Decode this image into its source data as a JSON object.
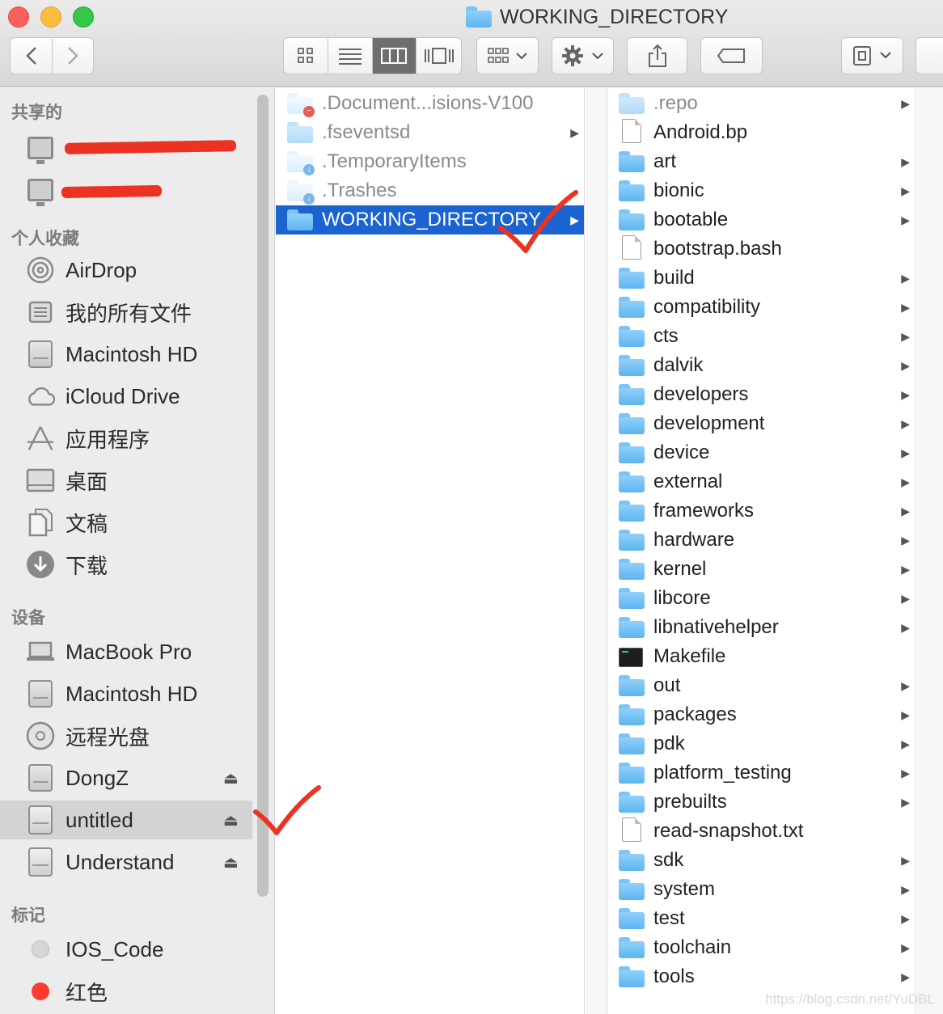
{
  "window": {
    "title": "WORKING_DIRECTORY"
  },
  "toolbar": {
    "back": "‹",
    "forward": "›",
    "view_modes": [
      "icon",
      "list",
      "column",
      "cover-flow"
    ],
    "active_view": "column"
  },
  "sidebar": {
    "sections": {
      "shared": "共享的",
      "favorites": "个人收藏",
      "devices": "设备",
      "tags": "标记"
    },
    "shared_items": [
      {
        "label": "",
        "icon": "monitor-icon"
      },
      {
        "label": "",
        "icon": "monitor-icon"
      }
    ],
    "favorites": [
      {
        "label": "AirDrop",
        "icon": "airdrop-icon"
      },
      {
        "label": "我的所有文件",
        "icon": "all-files-icon"
      },
      {
        "label": "Macintosh HD",
        "icon": "hard-drive-icon"
      },
      {
        "label": "iCloud Drive",
        "icon": "cloud-icon"
      },
      {
        "label": "应用程序",
        "icon": "applications-icon"
      },
      {
        "label": "桌面",
        "icon": "desktop-icon"
      },
      {
        "label": "文稿",
        "icon": "documents-icon"
      },
      {
        "label": "下载",
        "icon": "download-icon"
      }
    ],
    "devices": [
      {
        "label": "MacBook Pro",
        "icon": "laptop-icon",
        "eject": false
      },
      {
        "label": "Macintosh HD",
        "icon": "hard-drive-icon",
        "eject": false
      },
      {
        "label": "远程光盘",
        "icon": "optical-disc-icon",
        "eject": false
      },
      {
        "label": "DongZ",
        "icon": "hard-drive-icon",
        "eject": true
      },
      {
        "label": "untitled",
        "icon": "external-drive-icon",
        "eject": true,
        "selected": true
      },
      {
        "label": "Understand",
        "icon": "external-drive-icon",
        "eject": true
      }
    ],
    "tags": [
      {
        "label": "IOS_Code",
        "color": "#d0d0d0"
      },
      {
        "label": "红色",
        "color": "#fd3b30"
      }
    ],
    "eject_symbol": "⏏"
  },
  "column1": {
    "items": [
      {
        "name": ".Document...isions-V100",
        "icon": "folder-restricted-icon",
        "folder": true,
        "has_children": false,
        "dim": true
      },
      {
        "name": ".fseventsd",
        "icon": "folder-icon",
        "folder": true,
        "has_children": true,
        "dim": true
      },
      {
        "name": ".TemporaryItems",
        "icon": "folder-download-icon",
        "folder": true,
        "has_children": false,
        "dim": true
      },
      {
        "name": ".Trashes",
        "icon": "folder-download-icon",
        "folder": true,
        "has_children": false,
        "dim": true
      },
      {
        "name": "WORKING_DIRECTORY",
        "icon": "folder-icon",
        "folder": true,
        "has_children": true,
        "selected": true
      }
    ]
  },
  "column2": {
    "items": [
      {
        "name": ".repo",
        "type": "folder-light",
        "has_children": true,
        "dim": true
      },
      {
        "name": "Android.bp",
        "type": "file",
        "has_children": false
      },
      {
        "name": "art",
        "type": "folder",
        "has_children": true
      },
      {
        "name": "bionic",
        "type": "folder",
        "has_children": true
      },
      {
        "name": "bootable",
        "type": "folder",
        "has_children": true
      },
      {
        "name": "bootstrap.bash",
        "type": "script",
        "has_children": false
      },
      {
        "name": "build",
        "type": "folder",
        "has_children": true
      },
      {
        "name": "compatibility",
        "type": "folder",
        "has_children": true
      },
      {
        "name": "cts",
        "type": "folder",
        "has_children": true
      },
      {
        "name": "dalvik",
        "type": "folder",
        "has_children": true
      },
      {
        "name": "developers",
        "type": "folder",
        "has_children": true
      },
      {
        "name": "development",
        "type": "folder",
        "has_children": true
      },
      {
        "name": "device",
        "type": "folder",
        "has_children": true
      },
      {
        "name": "external",
        "type": "folder",
        "has_children": true
      },
      {
        "name": "frameworks",
        "type": "folder",
        "has_children": true
      },
      {
        "name": "hardware",
        "type": "folder",
        "has_children": true
      },
      {
        "name": "kernel",
        "type": "folder",
        "has_children": true
      },
      {
        "name": "libcore",
        "type": "folder",
        "has_children": true
      },
      {
        "name": "libnativehelper",
        "type": "folder",
        "has_children": true
      },
      {
        "name": "Makefile",
        "type": "terminal",
        "has_children": false
      },
      {
        "name": "out",
        "type": "folder",
        "has_children": true
      },
      {
        "name": "packages",
        "type": "folder",
        "has_children": true
      },
      {
        "name": "pdk",
        "type": "folder",
        "has_children": true
      },
      {
        "name": "platform_testing",
        "type": "folder",
        "has_children": true
      },
      {
        "name": "prebuilts",
        "type": "folder",
        "has_children": true
      },
      {
        "name": "read-snapshot.txt",
        "type": "file",
        "has_children": false
      },
      {
        "name": "sdk",
        "type": "folder",
        "has_children": true
      },
      {
        "name": "system",
        "type": "folder",
        "has_children": true
      },
      {
        "name": "test",
        "type": "folder",
        "has_children": true
      },
      {
        "name": "toolchain",
        "type": "folder",
        "has_children": true
      },
      {
        "name": "tools",
        "type": "folder",
        "has_children": true
      }
    ]
  },
  "colors": {
    "selection": "#1b63d1",
    "annotation_red": "#ea3323",
    "folder_blue": "#5eb5ef"
  },
  "watermark": "https://blog.csdn.net/YuDBL"
}
